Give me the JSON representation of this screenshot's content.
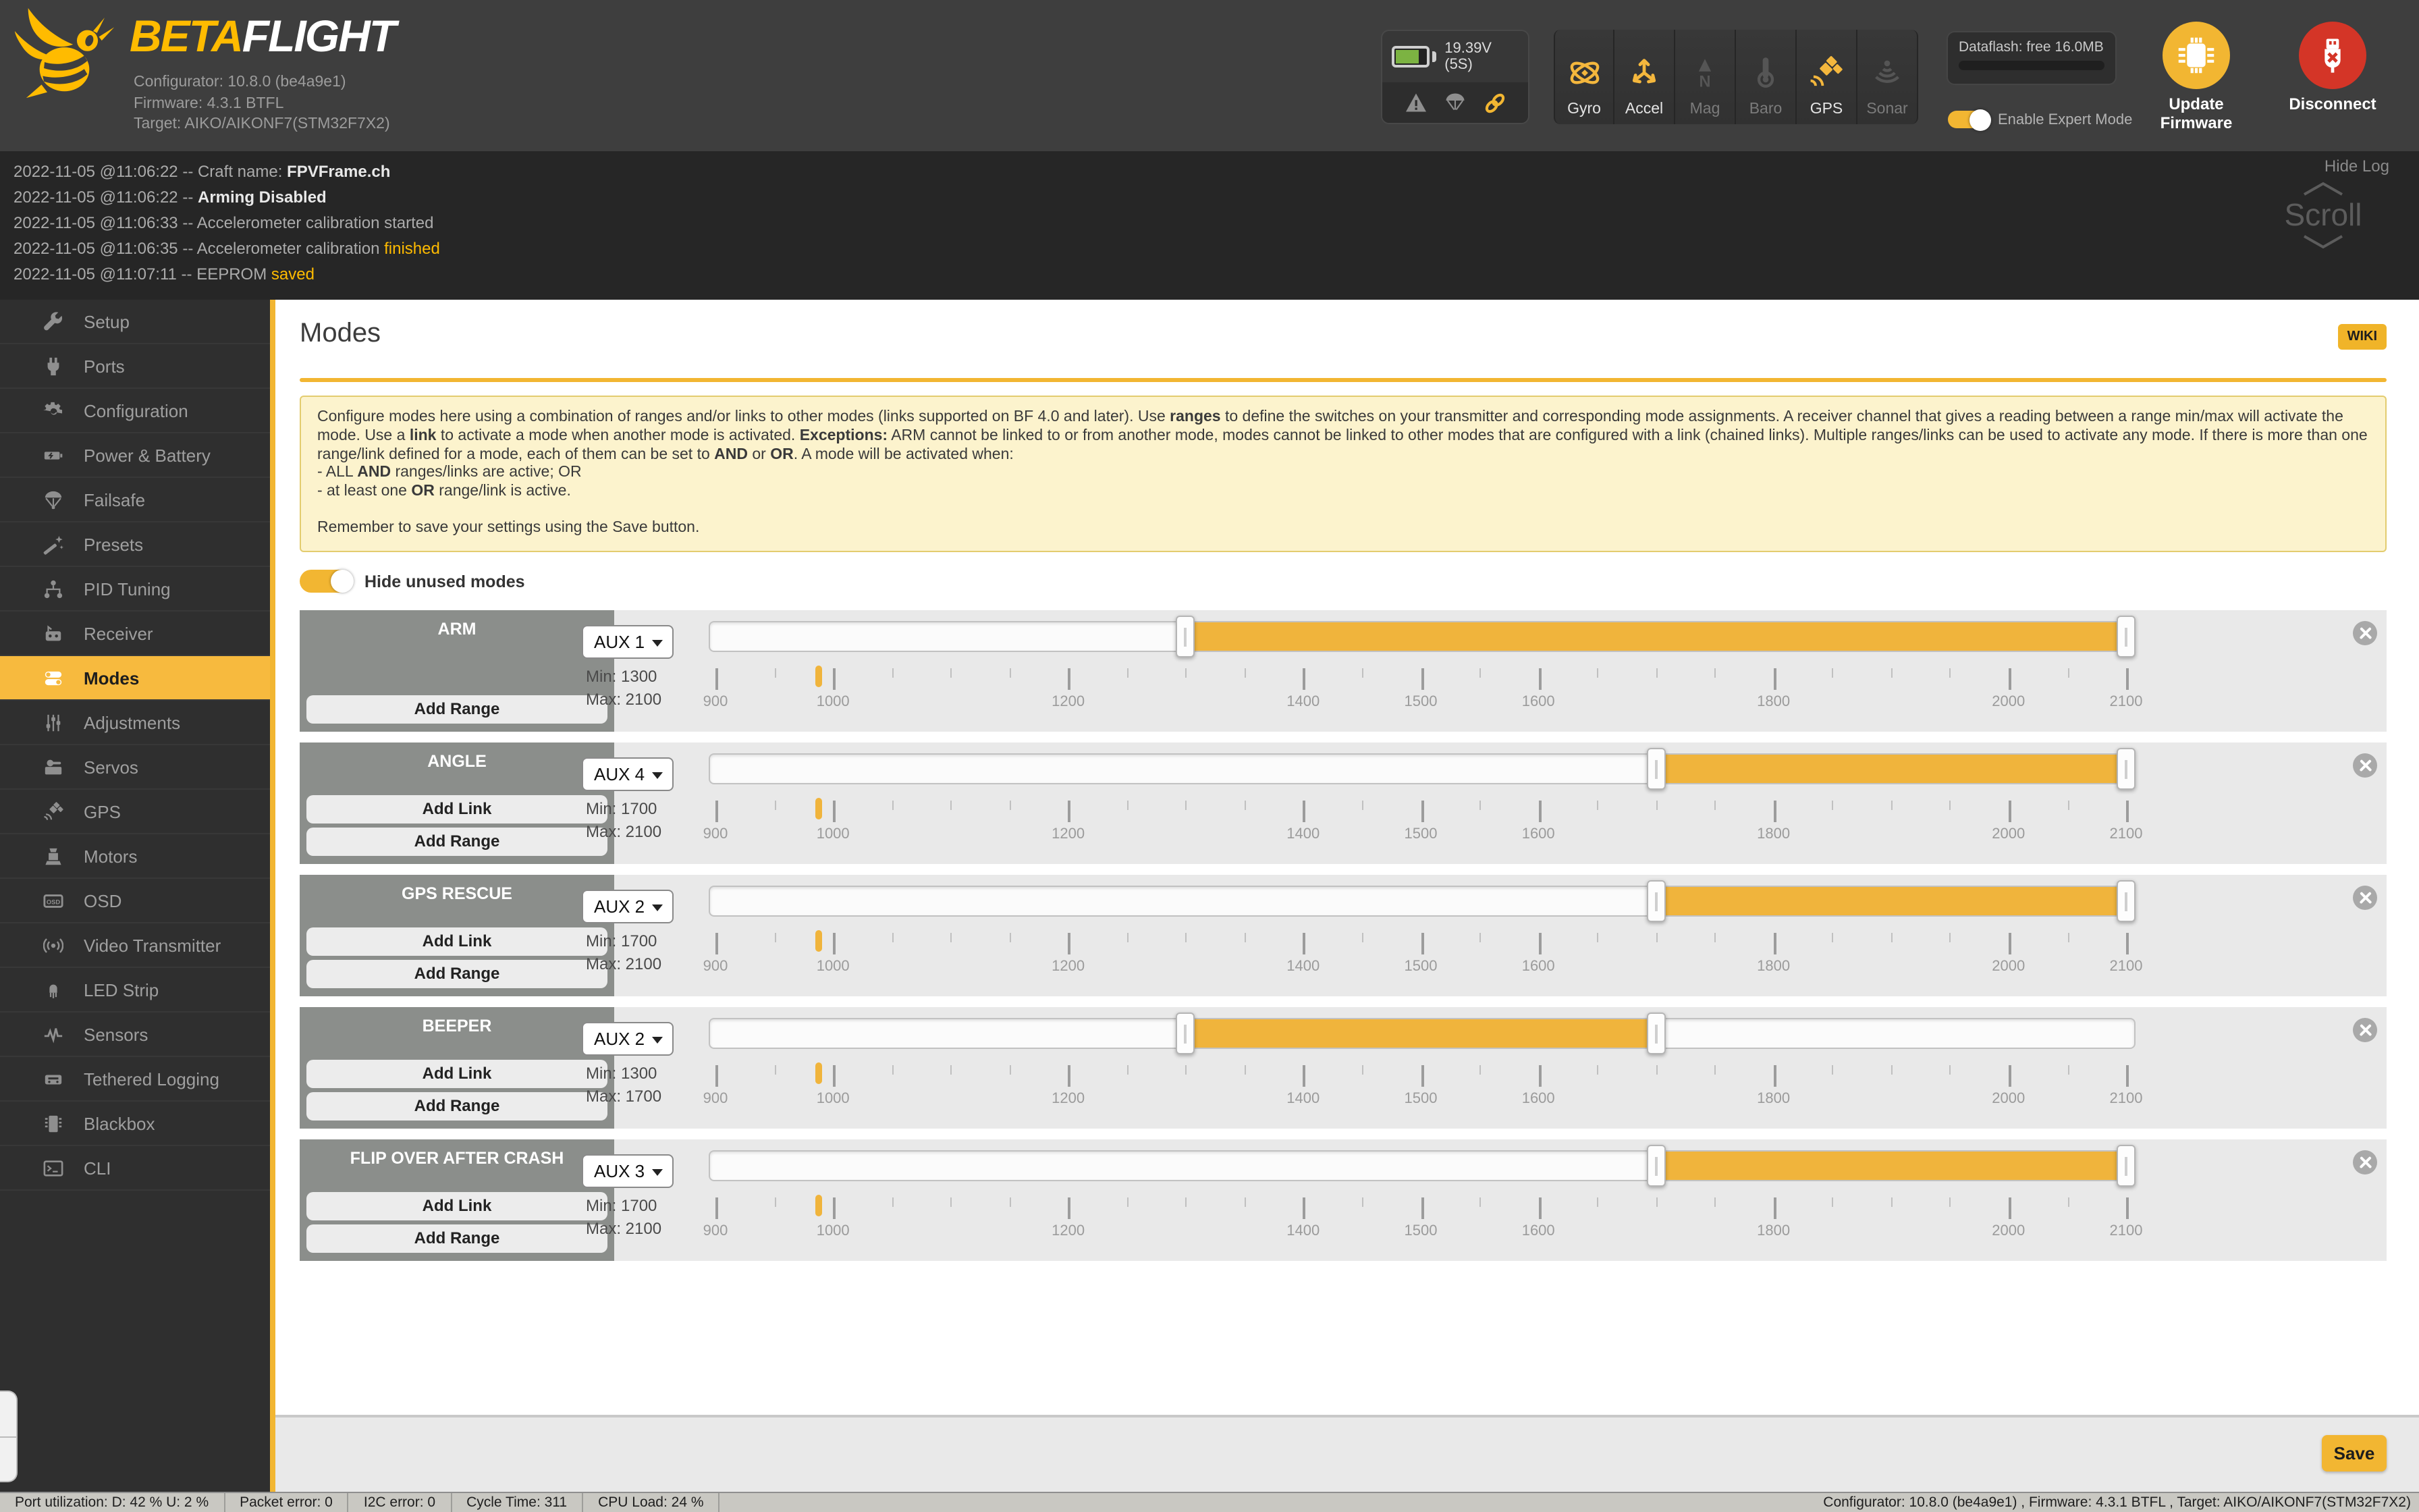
{
  "header": {
    "logo": {
      "beta": "BETA",
      "flight": "FLIGHT"
    },
    "info_lines": [
      "Configurator: 10.8.0 (be4a9e1)",
      "Firmware: 4.3.1 BTFL",
      "Target: AIKO/AIKONF7(STM32F7X2)"
    ],
    "battery": {
      "voltage": "19.39V (5S)"
    },
    "indicator_icons": [
      "warning-icon",
      "failsafe-icon",
      "link-icon"
    ],
    "sensors": [
      {
        "label": "Gyro",
        "icon": "gyro-icon",
        "active": true
      },
      {
        "label": "Accel",
        "icon": "accel-icon",
        "active": true
      },
      {
        "label": "Mag",
        "icon": "mag-icon",
        "active": false
      },
      {
        "label": "Baro",
        "icon": "baro-icon",
        "active": false
      },
      {
        "label": "GPS",
        "icon": "gps-icon",
        "active": true
      },
      {
        "label": "Sonar",
        "icon": "sonar-icon",
        "active": false
      }
    ],
    "dataflash_label": "Dataflash: free 16.0MB",
    "expert_mode": {
      "label": "Enable Expert Mode",
      "on": true
    },
    "update_firmware_label": "Update Firmware",
    "disconnect_label": "Disconnect"
  },
  "log": {
    "hide_label": "Hide Log",
    "scroll_label": "Scroll",
    "lines": [
      [
        {
          "t": "2022-11-05 @11:06:22 -- Craft name: "
        },
        {
          "t": "FPVFrame.ch",
          "s": "bold"
        }
      ],
      [
        {
          "t": "2022-11-05 @11:06:22 -- "
        },
        {
          "t": "Arming Disabled",
          "s": "bold"
        }
      ],
      [
        {
          "t": "2022-11-05 @11:06:33 -- Accelerometer calibration started"
        }
      ],
      [
        {
          "t": "2022-11-05 @11:06:35 -- Accelerometer calibration "
        },
        {
          "t": "finished",
          "s": "accent"
        }
      ],
      [
        {
          "t": "2022-11-05 @11:07:11 -- EEPROM "
        },
        {
          "t": "saved",
          "s": "accent"
        }
      ]
    ]
  },
  "sidebar": {
    "active_index": 8,
    "items": [
      {
        "label": "Setup",
        "icon": "wrench-icon"
      },
      {
        "label": "Ports",
        "icon": "plug-icon"
      },
      {
        "label": "Configuration",
        "icon": "gear-icon"
      },
      {
        "label": "Power & Battery",
        "icon": "battery-icon"
      },
      {
        "label": "Failsafe",
        "icon": "parachute-icon"
      },
      {
        "label": "Presets",
        "icon": "magic-wand-icon"
      },
      {
        "label": "PID Tuning",
        "icon": "pid-graph-icon"
      },
      {
        "label": "Receiver",
        "icon": "receiver-icon"
      },
      {
        "label": "Modes",
        "icon": "toggles-icon"
      },
      {
        "label": "Adjustments",
        "icon": "sliders-icon"
      },
      {
        "label": "Servos",
        "icon": "servo-icon"
      },
      {
        "label": "GPS",
        "icon": "satellite-icon"
      },
      {
        "label": "Motors",
        "icon": "motor-icon"
      },
      {
        "label": "OSD",
        "icon": "osd-icon"
      },
      {
        "label": "Video Transmitter",
        "icon": "broadcast-icon"
      },
      {
        "label": "LED Strip",
        "icon": "led-icon"
      },
      {
        "label": "Sensors",
        "icon": "pulse-icon"
      },
      {
        "label": "Tethered Logging",
        "icon": "logger-icon"
      },
      {
        "label": "Blackbox",
        "icon": "blackbox-icon"
      },
      {
        "label": "CLI",
        "icon": "terminal-icon"
      }
    ]
  },
  "main": {
    "title": "Modes",
    "wiki_label": "WIKI",
    "note_paragraphs": [
      [
        {
          "t": "Configure modes here using a combination of ranges and/or links to other modes (links supported on BF 4.0 and later). Use "
        },
        {
          "t": "ranges",
          "b": true
        },
        {
          "t": " to define the switches on your transmitter and corresponding mode assignments. A receiver channel that gives a reading between a range min/max will activate the mode. Use a "
        },
        {
          "t": "link",
          "b": true
        },
        {
          "t": " to activate a mode when another mode is activated. "
        },
        {
          "t": "Exceptions:",
          "b": true
        },
        {
          "t": " ARM cannot be linked to or from another mode, modes cannot be linked to other modes that are configured with a link (chained links). Multiple ranges/links can be used to activate any mode. If there is more than one range/link defined for a mode, each of them can be set to "
        },
        {
          "t": "AND",
          "b": true
        },
        {
          "t": " or "
        },
        {
          "t": "OR",
          "b": true
        },
        {
          "t": ". A mode will be activated when:"
        }
      ],
      [
        {
          "t": "- ALL "
        },
        {
          "t": "AND",
          "b": true
        },
        {
          "t": " ranges/links are active; OR"
        }
      ],
      [
        {
          "t": "- at least one "
        },
        {
          "t": "OR",
          "b": true
        },
        {
          "t": " range/link is active."
        }
      ],
      [],
      [
        {
          "t": "Remember to save your settings using the Save button."
        }
      ]
    ],
    "hide_unused": {
      "label": "Hide unused modes",
      "on": true
    },
    "min_prefix": "Min: ",
    "max_prefix": "Max: ",
    "ruler": {
      "min": 900,
      "max": 2100,
      "step": 50,
      "labeled": [
        900,
        1000,
        1200,
        1400,
        1500,
        1600,
        1800,
        2000,
        2100
      ]
    },
    "rx_value": 988,
    "modes": [
      {
        "name": "ARM",
        "aux": "AUX 1",
        "min": 1300,
        "max": 2100,
        "buttons": [
          "Add Range"
        ]
      },
      {
        "name": "ANGLE",
        "aux": "AUX 4",
        "min": 1700,
        "max": 2100,
        "buttons": [
          "Add Link",
          "Add Range"
        ]
      },
      {
        "name": "GPS RESCUE",
        "aux": "AUX 2",
        "min": 1700,
        "max": 2100,
        "buttons": [
          "Add Link",
          "Add Range"
        ]
      },
      {
        "name": "BEEPER",
        "aux": "AUX 2",
        "min": 1300,
        "max": 1700,
        "buttons": [
          "Add Link",
          "Add Range"
        ]
      },
      {
        "name": "FLIP OVER AFTER CRASH",
        "aux": "AUX 3",
        "min": 1700,
        "max": 2100,
        "buttons": [
          "Add Link",
          "Add Range"
        ]
      }
    ],
    "save_label": "Save"
  },
  "status_bar": {
    "cells": [
      "Port utilization: D: 42 % U: 2 %",
      "Packet error: 0",
      "I2C error: 0",
      "Cycle Time: 311",
      "CPU Load: 24 %"
    ],
    "right": "Configurator: 10.8.0 (be4a9e1) , Firmware: 4.3.1 BTFL , Target: AIKO/AIKONF7(STM32F7X2)"
  },
  "colors": {
    "accent": "#ffbb00",
    "slider_fill": "#f0b43c",
    "disconnect_red": "#d43527",
    "note_bg": "#fcf3cd"
  }
}
